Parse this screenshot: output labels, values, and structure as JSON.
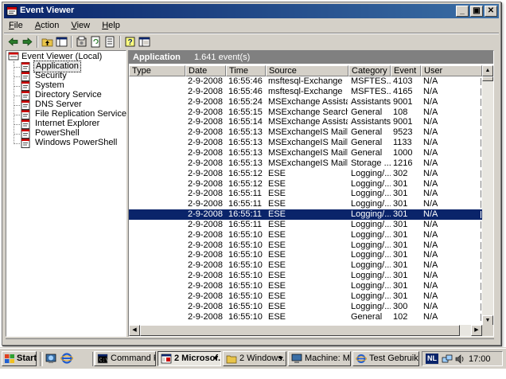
{
  "window": {
    "title": "Event Viewer",
    "icon": "event-viewer-icon"
  },
  "titlebar_buttons": {
    "minimize": "_",
    "restore": "▣",
    "close": "✕"
  },
  "menu": [
    {
      "accel": "F",
      "rest": "ile"
    },
    {
      "accel": "A",
      "rest": "ction"
    },
    {
      "accel": "V",
      "rest": "iew"
    },
    {
      "accel": "H",
      "rest": "elp"
    }
  ],
  "toolbar": [
    "back-arrow-icon",
    "forward-arrow-icon",
    "up-folder-icon",
    "show-hide-tree-icon",
    "properties-icon",
    "refresh-icon",
    "export-list-icon",
    "help-icon",
    "help-topics-icon"
  ],
  "tree": {
    "root": "Event Viewer (Local)",
    "items": [
      "Application",
      "Security",
      "System",
      "Directory Service",
      "DNS Server",
      "File Replication Service",
      "Internet Explorer",
      "PowerShell",
      "Windows PowerShell"
    ],
    "selected_index": 0
  },
  "list": {
    "title": "Application",
    "count": "1.641 event(s)",
    "columns": [
      "Type",
      "Date",
      "Time",
      "Source",
      "Category",
      "Event",
      "User"
    ],
    "selected_row": 13,
    "rows": [
      [
        "Information",
        "2-9-2008",
        "16:55:46",
        "msftesql-Exchange",
        "MSFTES...",
        "4103",
        "N/A"
      ],
      [
        "Information",
        "2-9-2008",
        "16:55:46",
        "msftesql-Exchange",
        "MSFTES...",
        "4165",
        "N/A"
      ],
      [
        "Information",
        "2-9-2008",
        "16:55:24",
        "MSExchange Assistants",
        "Assistants",
        "9001",
        "N/A"
      ],
      [
        "Information",
        "2-9-2008",
        "16:55:15",
        "MSExchange Search In...",
        "General",
        "108",
        "N/A"
      ],
      [
        "Information",
        "2-9-2008",
        "16:55:14",
        "MSExchange Assistants",
        "Assistants",
        "9001",
        "N/A"
      ],
      [
        "Information",
        "2-9-2008",
        "16:55:13",
        "MSExchangeIS Mailbox...",
        "General",
        "9523",
        "N/A"
      ],
      [
        "Information",
        "2-9-2008",
        "16:55:13",
        "MSExchangeIS Mailbox...",
        "General",
        "1133",
        "N/A"
      ],
      [
        "Information",
        "2-9-2008",
        "16:55:13",
        "MSExchangeIS Mailbox...",
        "General",
        "1000",
        "N/A"
      ],
      [
        "Information",
        "2-9-2008",
        "16:55:13",
        "MSExchangeIS Mailbox...",
        "Storage ...",
        "1216",
        "N/A"
      ],
      [
        "Information",
        "2-9-2008",
        "16:55:12",
        "ESE",
        "Logging/...",
        "302",
        "N/A"
      ],
      [
        "Information",
        "2-9-2008",
        "16:55:12",
        "ESE",
        "Logging/...",
        "301",
        "N/A"
      ],
      [
        "Information",
        "2-9-2008",
        "16:55:11",
        "ESE",
        "Logging/...",
        "301",
        "N/A"
      ],
      [
        "Information",
        "2-9-2008",
        "16:55:11",
        "ESE",
        "Logging/...",
        "301",
        "N/A"
      ],
      [
        "Information",
        "2-9-2008",
        "16:55:11",
        "ESE",
        "Logging/...",
        "301",
        "N/A"
      ],
      [
        "Information",
        "2-9-2008",
        "16:55:11",
        "ESE",
        "Logging/...",
        "301",
        "N/A"
      ],
      [
        "Information",
        "2-9-2008",
        "16:55:10",
        "ESE",
        "Logging/...",
        "301",
        "N/A"
      ],
      [
        "Information",
        "2-9-2008",
        "16:55:10",
        "ESE",
        "Logging/...",
        "301",
        "N/A"
      ],
      [
        "Information",
        "2-9-2008",
        "16:55:10",
        "ESE",
        "Logging/...",
        "301",
        "N/A"
      ],
      [
        "Information",
        "2-9-2008",
        "16:55:10",
        "ESE",
        "Logging/...",
        "301",
        "N/A"
      ],
      [
        "Information",
        "2-9-2008",
        "16:55:10",
        "ESE",
        "Logging/...",
        "301",
        "N/A"
      ],
      [
        "Information",
        "2-9-2008",
        "16:55:10",
        "ESE",
        "Logging/...",
        "301",
        "N/A"
      ],
      [
        "Information",
        "2-9-2008",
        "16:55:10",
        "ESE",
        "Logging/...",
        "301",
        "N/A"
      ],
      [
        "Information",
        "2-9-2008",
        "16:55:10",
        "ESE",
        "Logging/...",
        "300",
        "N/A"
      ],
      [
        "Information",
        "2-9-2008",
        "16:55:10",
        "ESE",
        "General",
        "102",
        "N/A"
      ]
    ]
  },
  "taskbar": {
    "start_label": "Start",
    "tasks": [
      {
        "label": "Command Pr...",
        "icon": "command-prompt-icon",
        "active": false,
        "group": false
      },
      {
        "label": "2 Microsof...",
        "icon": "mmc-icon",
        "active": true,
        "group": true
      },
      {
        "label": "2 Windows...",
        "icon": "folder-icon",
        "active": false,
        "group": true
      },
      {
        "label": "Machine: MB...",
        "icon": "computer-icon",
        "active": false,
        "group": false
      },
      {
        "label": "Test Gebruik...",
        "icon": "internet-explorer-icon",
        "active": false,
        "group": false
      }
    ],
    "language": "NL",
    "clock": "17:00"
  },
  "colors": {
    "title_start": "#0a246a",
    "title_end": "#3a6ea5",
    "selection": "#0a246a",
    "face": "#d4d0c8"
  }
}
